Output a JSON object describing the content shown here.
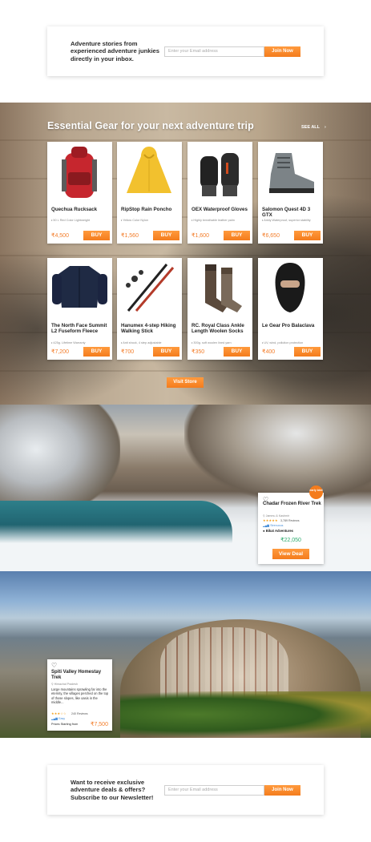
{
  "newsletter_top": {
    "text": "Adventure stories from experienced adventure junkies directly in your inbox.",
    "placeholder": "Enter your Email address",
    "button": "Join Now"
  },
  "gear": {
    "title": "Essential Gear for your next adventure trip",
    "see_all": "SEE ALL",
    "products": [
      {
        "name": "Quechua Rucksack",
        "spec": "50 L Red Color Lightweight",
        "price": "₹4,500",
        "buy": "BUY",
        "icon": "backpack-icon"
      },
      {
        "name": "RipStop Rain Poncho",
        "spec": "Yellow Color Nylon",
        "price": "₹1,560",
        "buy": "BUY",
        "icon": "poncho-icon"
      },
      {
        "name": "OEX Waterproof Gloves",
        "spec": "Highly breathable leather palm",
        "price": "₹1,600",
        "buy": "BUY",
        "icon": "gloves-icon"
      },
      {
        "name": "Salomon Quest 4D 3 GTX",
        "spec": "Ankly Waterproof, superior stability",
        "price": "₹6,650",
        "buy": "BUY",
        "icon": "boot-icon"
      },
      {
        "name": "The North Face Summit L2 Fuseform Fleece",
        "spec": "425g. Lifetime Warranty",
        "price": "₹7,200",
        "buy": "BUY",
        "icon": "fleece-icon"
      },
      {
        "name": "Hanumex 4-step Hiking Walking Stick",
        "spec": "Anti shock, 4 step adjustable",
        "price": "₹700",
        "buy": "BUY",
        "icon": "hiking-stick-icon"
      },
      {
        "name": "RC. Royal Class Ankle Length Woolen Socks",
        "spec": "300g. soft woolen lined yarn",
        "price": "₹350",
        "buy": "BUY",
        "icon": "socks-icon"
      },
      {
        "name": "Le Gear Pro Balaclava",
        "spec": "UV, wind, pollution protection",
        "price": "₹400",
        "buy": "BUY",
        "icon": "balaclava-icon"
      }
    ],
    "visit_store": "Visit Store"
  },
  "chadar": {
    "badge": "early bird",
    "title": "Chadar Frozen River Trek",
    "location": "Jammu & Kashmir",
    "stars": "★★★★★",
    "reviews": "3,789 Reviews",
    "level": "Strenuous",
    "operator": "Bikat Adventures",
    "price": "₹22,050",
    "button": "View Deal"
  },
  "spiti": {
    "title": "Spiti Valley Homestay Trek",
    "location": "Himachal Pradesh",
    "description": "Large mountains sprawling far into the eternity, the villages perched on the top of those slopes, like oasis in the middle...",
    "stars": "★★★☆☆",
    "reviews": "240 Reviews",
    "level": "Easy",
    "from_label": "Prices Starting from",
    "price": "₹7,500"
  },
  "newsletter_bottom": {
    "text": "Want to receive exclusive adventure deals & offers? Subscribe to our Newsletter!",
    "placeholder": "Enter your Email address",
    "button": "Join Now"
  },
  "colors": {
    "accent": "#f47c1d",
    "price_green": "#2eab6f"
  }
}
